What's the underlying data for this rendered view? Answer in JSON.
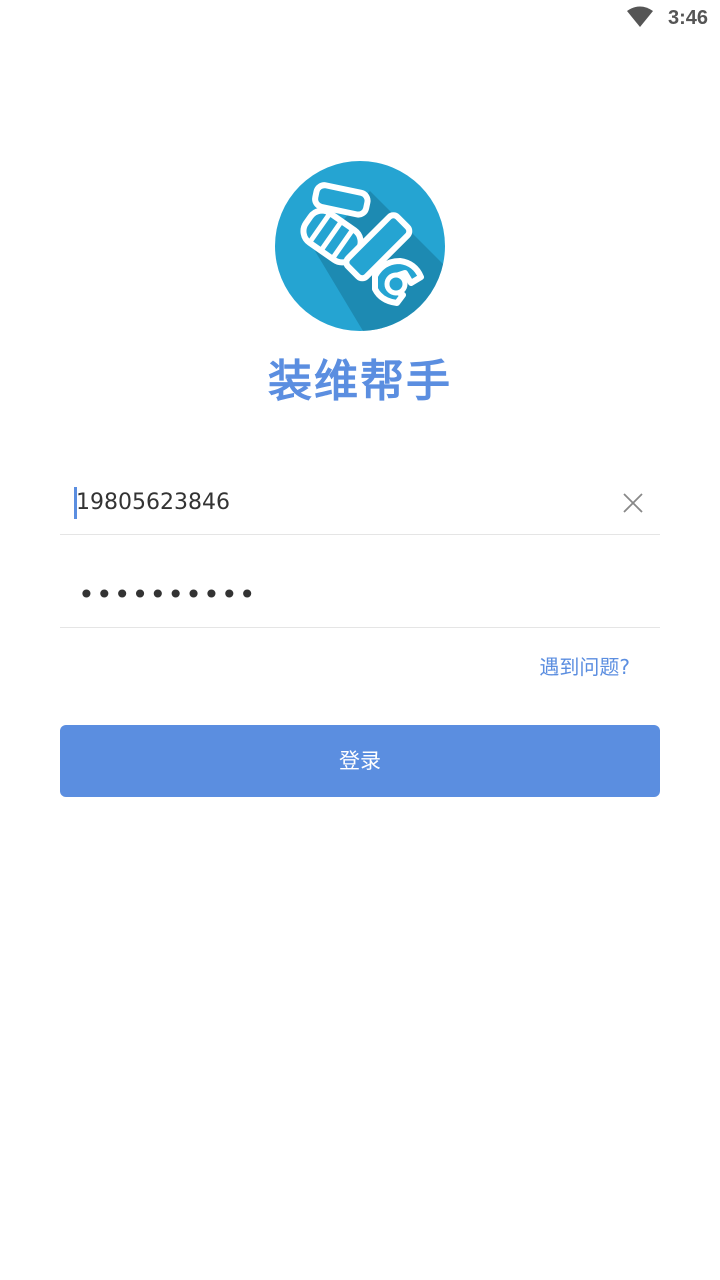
{
  "status_bar": {
    "time": "3:46",
    "icons": [
      "wifi-icon"
    ]
  },
  "app": {
    "name": "装维帮手",
    "logo_icon": "wrench-hand-logo-icon",
    "brand_color": "#5b8ee0",
    "logo_bg_color": "#25a4d2"
  },
  "login_form": {
    "phone_value": "19805623846",
    "password_masked": "••••••••••",
    "clear_icon": "close-icon",
    "help_label": "遇到问题?",
    "login_label": "登录"
  }
}
